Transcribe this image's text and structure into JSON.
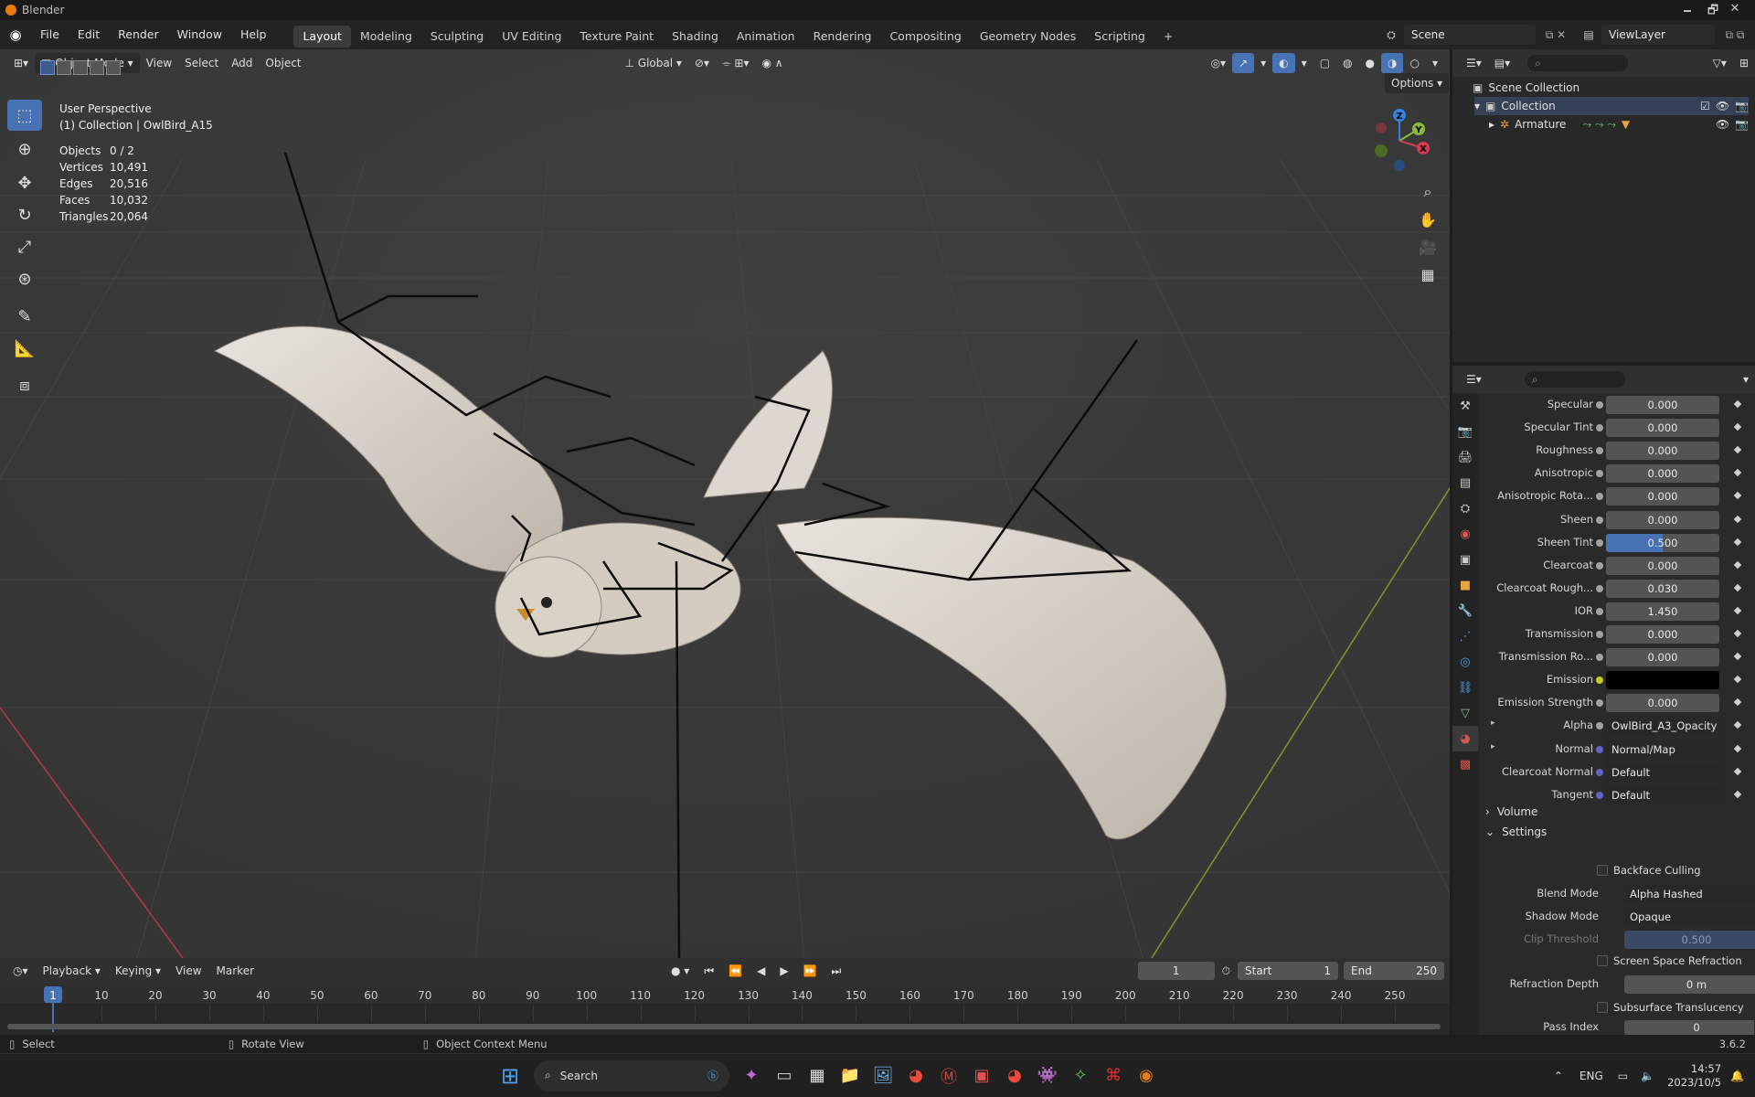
{
  "window": {
    "title": "Blender",
    "minimize": "🗕",
    "maximize": "🗗",
    "close": "✕"
  },
  "menu": {
    "items": [
      "File",
      "Edit",
      "Render",
      "Window",
      "Help"
    ]
  },
  "workspaces": {
    "tabs": [
      "Layout",
      "Modeling",
      "Sculpting",
      "UV Editing",
      "Texture Paint",
      "Shading",
      "Animation",
      "Rendering",
      "Compositing",
      "Geometry Nodes",
      "Scripting"
    ],
    "active": "Layout",
    "add": "+"
  },
  "scene": {
    "name": "Scene",
    "view_layer": "ViewLayer"
  },
  "viewport": {
    "mode": "Object Mode",
    "menus": [
      "View",
      "Select",
      "Add",
      "Object"
    ],
    "orientation": "Global",
    "options_label": "Options",
    "overlay_title": "User Perspective",
    "overlay_subtitle": "(1) Collection | OwlBird_A15",
    "stats": [
      {
        "label": "Objects",
        "value": "0 / 2"
      },
      {
        "label": "Vertices",
        "value": "10,491"
      },
      {
        "label": "Edges",
        "value": "20,516"
      },
      {
        "label": "Faces",
        "value": "10,032"
      },
      {
        "label": "Triangles",
        "value": "20,064"
      }
    ],
    "gizmo_axes": {
      "x": "X",
      "y": "Y",
      "z": "Z"
    },
    "colors": {
      "bg": "#393939",
      "x_axis": "#d23c4f",
      "y_axis": "#8ab839",
      "z_axis": "#2f84e3"
    }
  },
  "outliner": {
    "root": "Scene Collection",
    "collection": "Collection",
    "object": "Armature"
  },
  "properties": {
    "rows": [
      {
        "label": "Specular",
        "value": "0.000",
        "type": "num"
      },
      {
        "label": "Specular Tint",
        "value": "0.000",
        "type": "num"
      },
      {
        "label": "Roughness",
        "value": "0.000",
        "type": "num"
      },
      {
        "label": "Anisotropic",
        "value": "0.000",
        "type": "num"
      },
      {
        "label": "Anisotropic Rota...",
        "value": "0.000",
        "type": "num"
      },
      {
        "label": "Sheen",
        "value": "0.000",
        "type": "num"
      },
      {
        "label": "Sheen Tint",
        "value": "0.500",
        "type": "slider",
        "fill": 0.5
      },
      {
        "label": "Clearcoat",
        "value": "0.000",
        "type": "num"
      },
      {
        "label": "Clearcoat Rough...",
        "value": "0.030",
        "type": "num"
      },
      {
        "label": "IOR",
        "value": "1.450",
        "type": "num"
      },
      {
        "label": "Transmission",
        "value": "0.000",
        "type": "num"
      },
      {
        "label": "Transmission Ro...",
        "value": "0.000",
        "type": "num"
      },
      {
        "label": "Emission",
        "value": "",
        "type": "color"
      },
      {
        "label": "Emission Strength",
        "value": "0.000",
        "type": "num"
      },
      {
        "label": "Alpha",
        "value": "OwlBird_A3_Opacity",
        "type": "link"
      },
      {
        "label": "Normal",
        "value": "Normal/Map",
        "type": "link"
      },
      {
        "label": "Clearcoat Normal",
        "value": "Default",
        "type": "link"
      },
      {
        "label": "Tangent",
        "value": "Default",
        "type": "link"
      }
    ],
    "volume_label": "Volume",
    "settings_label": "Settings",
    "backface_culling": "Backface Culling",
    "blend_mode_label": "Blend Mode",
    "blend_mode_value": "Alpha Hashed",
    "shadow_mode_label": "Shadow Mode",
    "shadow_mode_value": "Opaque",
    "clip_threshold_label": "Clip Threshold",
    "clip_threshold_value": "0.500",
    "screen_space_refraction": "Screen Space Refraction",
    "refraction_depth_label": "Refraction Depth",
    "refraction_depth_value": "0 m",
    "subsurface_translucency": "Subsurface Translucency",
    "pass_index_label": "Pass Index",
    "pass_index_value": "0"
  },
  "timeline": {
    "menus": [
      "Playback",
      "Keying",
      "View",
      "Marker"
    ],
    "current_frame": "1",
    "start_label": "Start",
    "start_value": "1",
    "end_label": "End",
    "end_value": "250",
    "ticks": [
      "1",
      "10",
      "20",
      "30",
      "40",
      "50",
      "60",
      "70",
      "80",
      "90",
      "100",
      "110",
      "120",
      "130",
      "140",
      "150",
      "160",
      "170",
      "180",
      "190",
      "200",
      "210",
      "220",
      "230",
      "240",
      "250"
    ]
  },
  "status": {
    "select": "Select",
    "rotate": "Rotate View",
    "context": "Object Context Menu",
    "version": "3.6.2"
  },
  "taskbar": {
    "search": "Search",
    "lang": "ENG",
    "time": "14:57",
    "date": "2023/10/5"
  }
}
